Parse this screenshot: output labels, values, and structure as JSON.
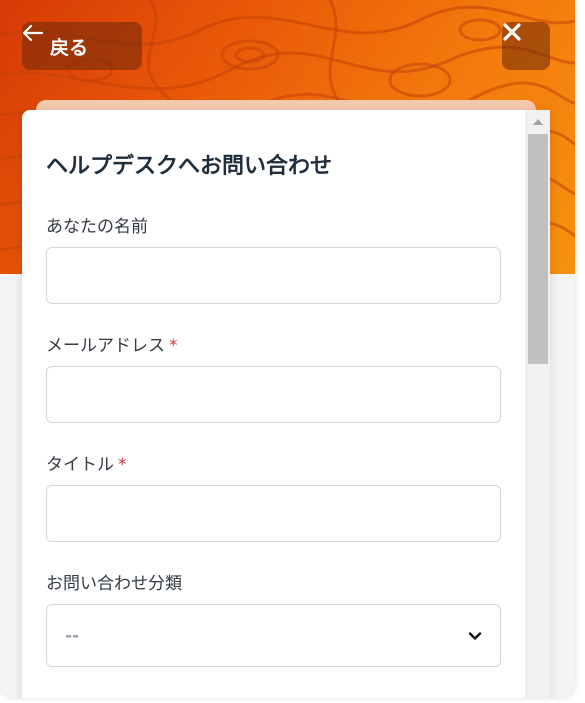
{
  "header": {
    "back_label": "戻る",
    "back_icon": "arrow-left-icon",
    "close_icon": "close-icon"
  },
  "form": {
    "title": "ヘルプデスクへお問い合わせ",
    "required_marker": "*",
    "name_field": {
      "label": "あなたの名前",
      "value": "",
      "required": false
    },
    "email_field": {
      "label": "メールアドレス",
      "value": "",
      "required": true
    },
    "title_field": {
      "label": "タイトル",
      "value": "",
      "required": true
    },
    "category_field": {
      "label": "お問い合わせ分類",
      "selected": "--",
      "icon": "chevron-down-icon"
    }
  },
  "colors": {
    "banner_start": "#d63a06",
    "banner_end": "#f6920f",
    "required": "#d9363e",
    "title_text": "#1f2d3d"
  }
}
